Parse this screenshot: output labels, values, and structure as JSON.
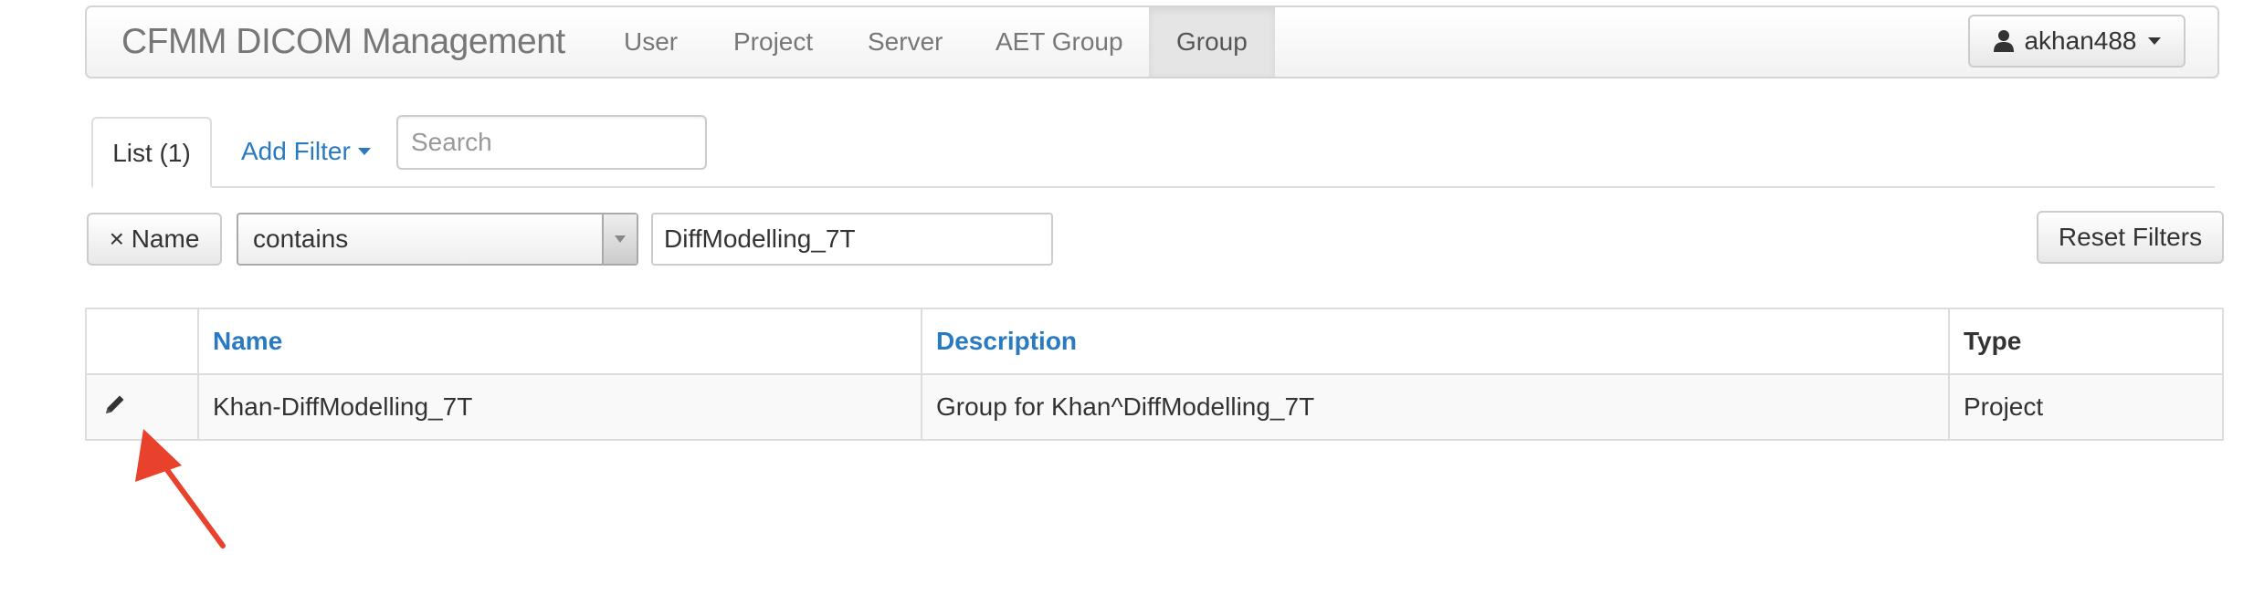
{
  "navbar": {
    "brand": "CFMM DICOM Management",
    "links": [
      {
        "label": "User",
        "active": false
      },
      {
        "label": "Project",
        "active": false
      },
      {
        "label": "Server",
        "active": false
      },
      {
        "label": "AET Group",
        "active": false
      },
      {
        "label": "Group",
        "active": true
      }
    ],
    "user_menu": {
      "label": "akhan488",
      "icon": "user-icon"
    }
  },
  "tabs": {
    "list_label": "List (1)",
    "add_filter_label": "Add Filter",
    "search_placeholder": "Search"
  },
  "filter": {
    "remove_name_label": "× Name",
    "operator": "contains",
    "value": "DiffModelling_7T",
    "reset_label": "Reset Filters"
  },
  "table": {
    "columns": [
      "",
      "Name",
      "Description",
      "Type"
    ],
    "rows": [
      {
        "name": "Khan-DiffModelling_7T",
        "description": "Group for Khan^DiffModelling_7T",
        "type": "Project",
        "edit_icon": "pencil-icon"
      }
    ]
  },
  "annotation": {
    "color": "#e8412c",
    "icon": "arrow-icon"
  },
  "colors": {
    "link": "#2a7ac2",
    "active_nav_bg": "#e5e5e5"
  }
}
